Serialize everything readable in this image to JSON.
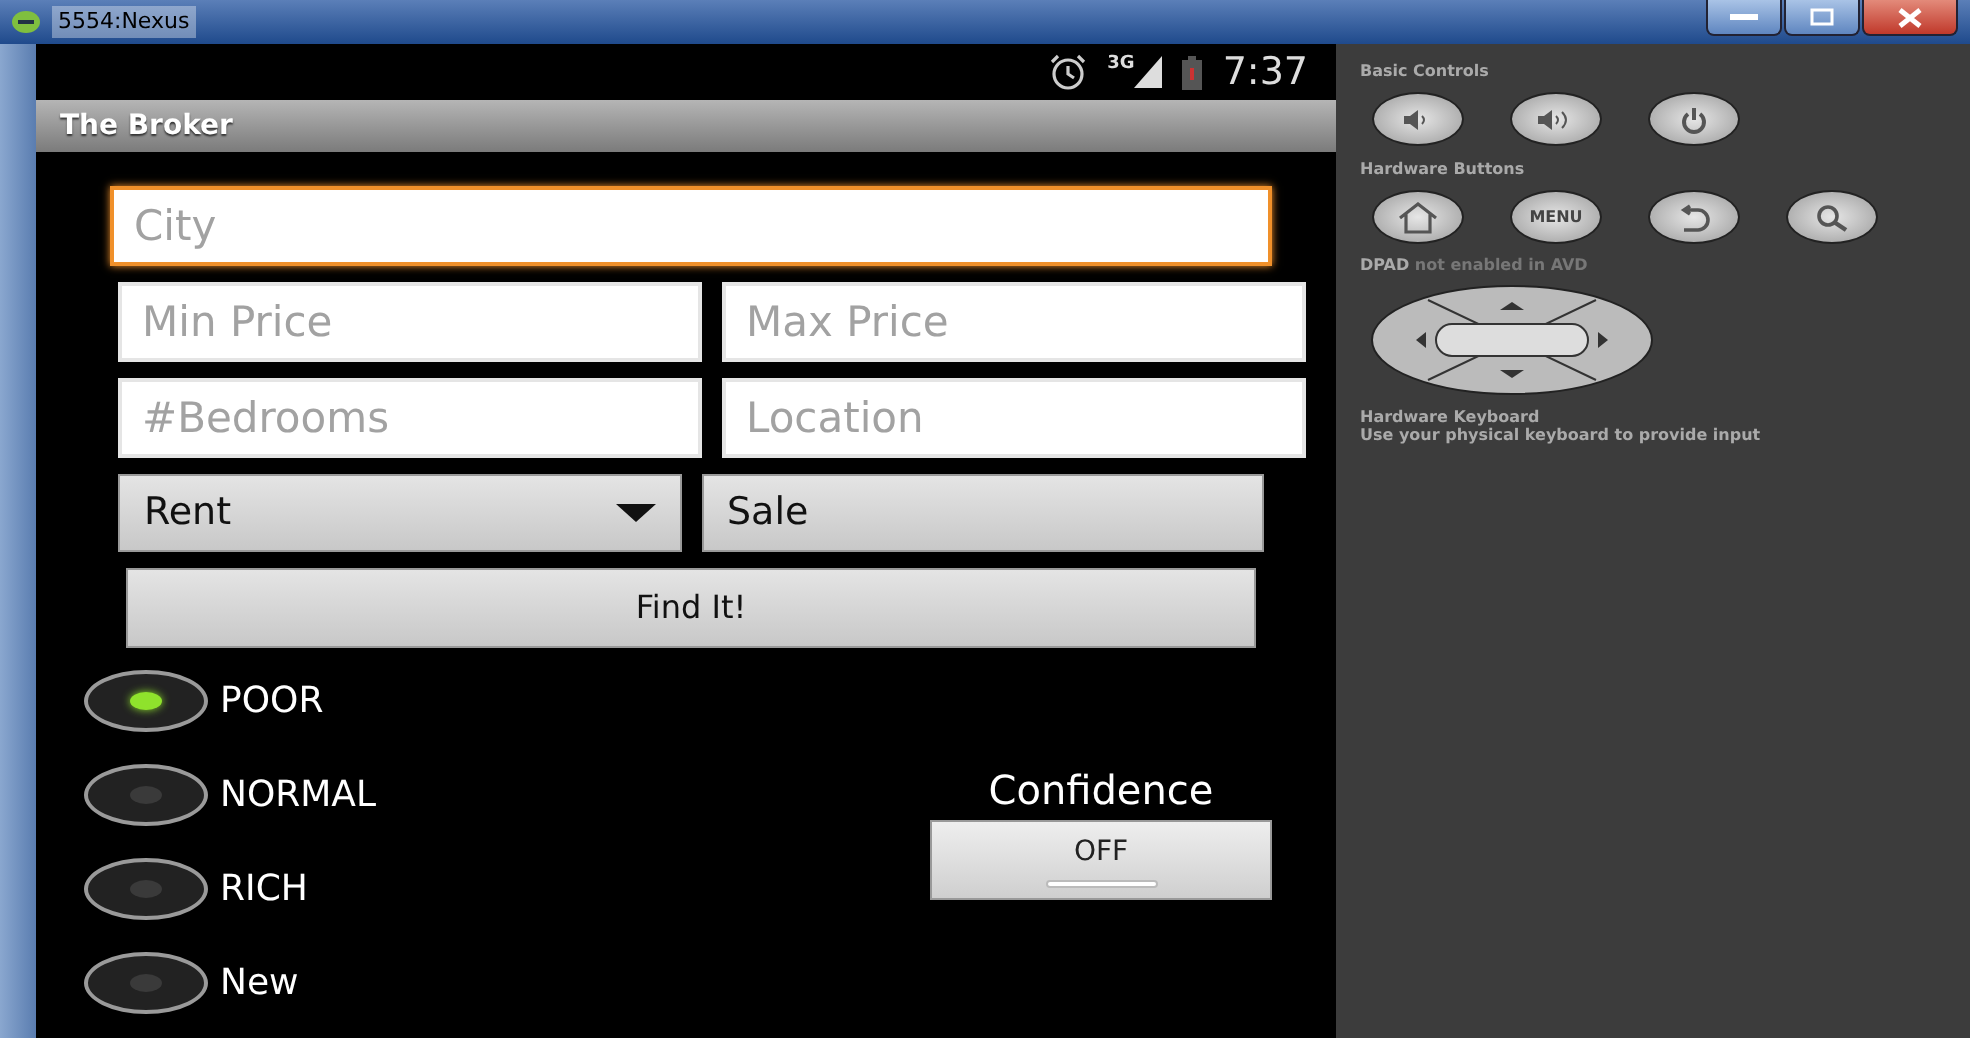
{
  "window": {
    "title": "5554:Nexus"
  },
  "status_bar": {
    "network": "3G",
    "time": "7:37"
  },
  "action_bar": {
    "title": "The Broker"
  },
  "form_rows": [
    [
      {
        "kind": "field",
        "placeholder": "City",
        "focused": true
      }
    ],
    [
      {
        "kind": "field",
        "placeholder": "Min Price",
        "focused": false
      },
      {
        "kind": "field",
        "placeholder": "Max Price",
        "focused": false
      }
    ],
    [
      {
        "kind": "field",
        "placeholder": "#Bedrooms",
        "focused": false
      },
      {
        "kind": "field",
        "placeholder": "Location",
        "focused": false
      }
    ],
    [
      {
        "kind": "spinner",
        "value": "Rent"
      },
      {
        "kind": "button",
        "label": "Sale"
      }
    ]
  ],
  "find_button": {
    "label": "Find It!"
  },
  "radio_options": [
    {
      "label": "POOR",
      "selected": true
    },
    {
      "label": "NORMAL",
      "selected": false
    },
    {
      "label": "RICH",
      "selected": false
    },
    {
      "label": "New",
      "selected": false
    }
  ],
  "toggle": {
    "label": "Confidence",
    "text": "OFF",
    "on": false
  },
  "emulator_controls": {
    "basic_controls_title": "Basic Controls",
    "hardware_buttons_title": "Hardware Buttons",
    "menu_label": "MENU",
    "dpad_note": "**DPAD** not enabled in AVD",
    "keyboard_title": "Hardware Keyboard",
    "keyboard_note": "Use your physical keyboard to provide input"
  }
}
